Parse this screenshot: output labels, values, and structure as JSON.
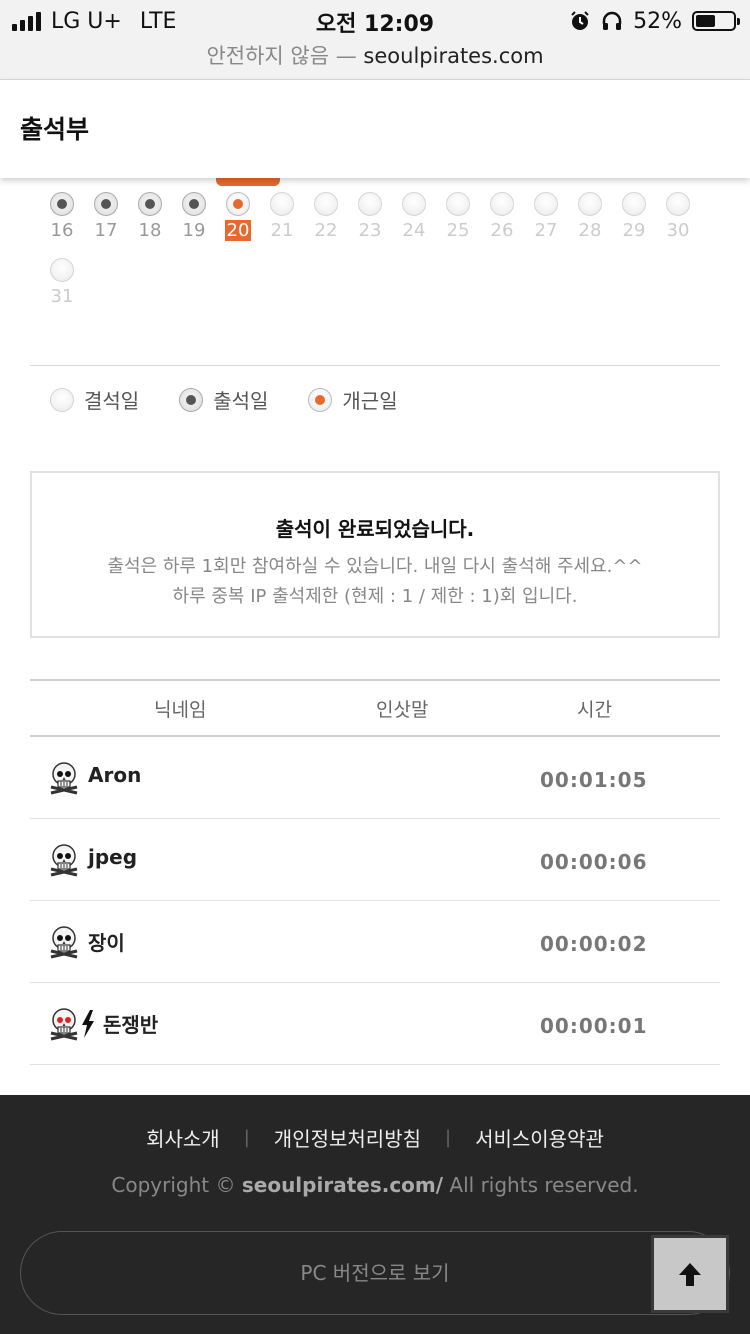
{
  "status_bar": {
    "carrier": "LG U+",
    "network": "LTE",
    "time": "오전 12:09",
    "battery_percent": "52%",
    "battery_level": 0.52,
    "icons": [
      "signal-icon",
      "alarm-icon",
      "headphones-icon",
      "battery-icon"
    ]
  },
  "browser": {
    "insecure_label": "안전하지 않음",
    "dash": "—",
    "domain": "seoulpirates.com"
  },
  "header": {
    "title": "출석부"
  },
  "calendar": {
    "days": [
      {
        "label": "16",
        "state": "attended"
      },
      {
        "label": "17",
        "state": "attended"
      },
      {
        "label": "18",
        "state": "attended"
      },
      {
        "label": "19",
        "state": "attended"
      },
      {
        "label": "20",
        "state": "perfect",
        "today": true
      },
      {
        "label": "21",
        "state": "future"
      },
      {
        "label": "22",
        "state": "future"
      },
      {
        "label": "23",
        "state": "future"
      },
      {
        "label": "24",
        "state": "future"
      },
      {
        "label": "25",
        "state": "future"
      },
      {
        "label": "26",
        "state": "future"
      },
      {
        "label": "27",
        "state": "future"
      },
      {
        "label": "28",
        "state": "future"
      },
      {
        "label": "29",
        "state": "future"
      },
      {
        "label": "30",
        "state": "future"
      },
      {
        "label": "31",
        "state": "future"
      }
    ]
  },
  "legend": {
    "absent": "결석일",
    "attended": "출석일",
    "perfect": "개근일"
  },
  "notice": {
    "title": "출석이 완료되었습니다.",
    "line1": "출석은 하루 1회만 참여하실 수 있습니다. 내일 다시 출석해 주세요.^^",
    "line2": "하루 중복 IP 출석제한 (현제 : 1 / 제한 : 1)회 입니다."
  },
  "table": {
    "headers": {
      "nickname": "닉네임",
      "greeting": "인삿말",
      "time": "시간"
    },
    "rows": [
      {
        "nickname": "Aron",
        "greeting": "",
        "time": "00:01:05",
        "icons": [
          "skull-icon"
        ]
      },
      {
        "nickname": "jpeg",
        "greeting": "",
        "time": "00:00:06",
        "icons": [
          "skull-icon"
        ]
      },
      {
        "nickname": "장이",
        "greeting": "",
        "time": "00:00:02",
        "icons": [
          "skull-icon"
        ]
      },
      {
        "nickname": "돈쟁반",
        "greeting": "",
        "time": "00:00:01",
        "icons": [
          "skull-icon-red",
          "lightning-icon"
        ]
      }
    ]
  },
  "footer": {
    "links": [
      "회사소개",
      "개인정보처리방침",
      "서비스이용약관"
    ],
    "copyright_prefix": "Copyright ©",
    "copyright_domain": "seoulpirates.com/",
    "copyright_suffix": "All rights reserved.",
    "pc_version": "PC 버전으로 보기"
  },
  "colors": {
    "accent": "#e8692d",
    "footer_bg": "#262626"
  }
}
